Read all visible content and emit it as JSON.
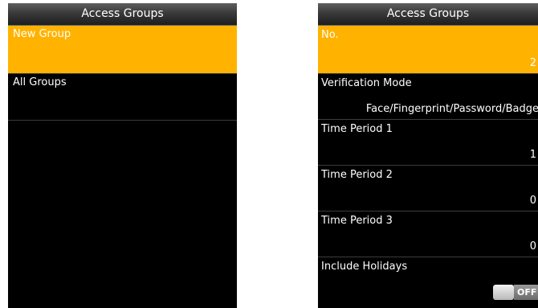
{
  "left": {
    "title": "Access Groups",
    "items": [
      {
        "label": "New Group"
      },
      {
        "label": "All Groups"
      }
    ]
  },
  "right": {
    "title": "Access Groups",
    "fields": [
      {
        "label": "No.",
        "value": "2"
      },
      {
        "label": "Verification Mode",
        "value": "Face/Fingerprint/Password/Badge"
      },
      {
        "label": "Time Period 1",
        "value": "1"
      },
      {
        "label": "Time Period 2",
        "value": "0"
      },
      {
        "label": "Time Period 3",
        "value": "0"
      },
      {
        "label": "Include Holidays",
        "toggle": "OFF"
      }
    ]
  },
  "colors": {
    "highlight": "#ffb300",
    "screen_bg": "#000000"
  }
}
